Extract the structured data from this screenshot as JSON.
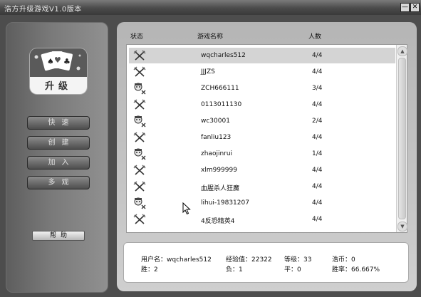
{
  "window": {
    "title": "浩方升级游戏V1.0版本",
    "minimize_glyph": "—",
    "close_glyph": "✕"
  },
  "sidebar": {
    "logo_label": "升级",
    "buttons": [
      {
        "label": "快速"
      },
      {
        "label": "创建"
      },
      {
        "label": "加入"
      },
      {
        "label": "多观"
      }
    ],
    "help_label": "帮助"
  },
  "table": {
    "headers": {
      "status": "状态",
      "name": "游戏名称",
      "players": "人数"
    },
    "rows": [
      {
        "status_icon": "crossed-swords-icon",
        "name": "wqcharles512",
        "players": "4/4",
        "selected": true
      },
      {
        "status_icon": "crossed-swords-icon",
        "name": "JJJZS",
        "players": "4/4"
      },
      {
        "status_icon": "waiting-player-icon",
        "name": "ZCH666111",
        "players": "3/4"
      },
      {
        "status_icon": "crossed-swords-icon",
        "name": "0113011130",
        "players": "4/4"
      },
      {
        "status_icon": "waiting-player-icon",
        "name": "wc30001",
        "players": "2/4"
      },
      {
        "status_icon": "crossed-swords-icon",
        "name": "fanliu123",
        "players": "4/4"
      },
      {
        "status_icon": "waiting-player-icon",
        "name": "zhaojinrui",
        "players": "1/4"
      },
      {
        "status_icon": "crossed-swords-icon",
        "name": "xlm999999",
        "players": "4/4"
      },
      {
        "status_icon": "crossed-swords-icon",
        "name": "血腥杀人狂魔",
        "players": "4/4"
      },
      {
        "status_icon": "waiting-player-icon",
        "name": "lihui-19831207",
        "players": "4/4"
      },
      {
        "status_icon": "crossed-swords-icon",
        "name": "4反恐精英4",
        "players": "4/4"
      }
    ]
  },
  "user_info": {
    "username": "用户名：wqcharles512",
    "experience": "经验值：22322",
    "level": "等级：33",
    "coins": "浩币：0",
    "wins": "胜：2",
    "losses": "负：1",
    "draws": "平：0",
    "win_rate": "胜率：66.667%"
  },
  "scroll": {
    "up_glyph": "▲",
    "down_glyph": "▼"
  },
  "colors": {
    "titlebar": "#4a4a4a",
    "frame": "#4d4d4d",
    "selected_row": "#d4d4d4"
  }
}
